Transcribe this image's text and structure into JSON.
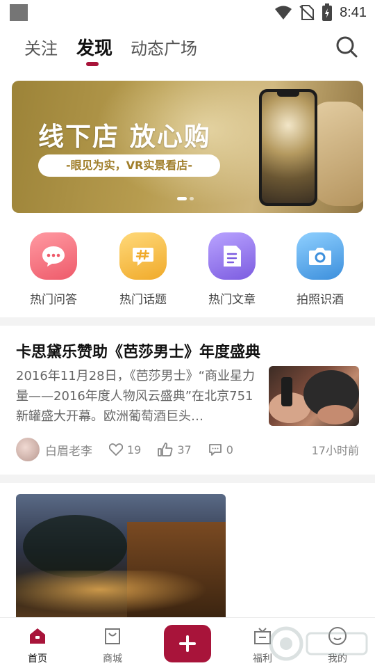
{
  "status_bar": {
    "time": "8:41"
  },
  "tabs": [
    {
      "label": "关注"
    },
    {
      "label": "发现"
    },
    {
      "label": "动态广场"
    }
  ],
  "banner": {
    "title": "线下店 放心购",
    "subtitle": "-眼见为实，VR实景看店-",
    "slide_count": 2,
    "active_slide": 1
  },
  "quick_links": [
    {
      "label": "热门问答",
      "icon": "chat-bubble-icon",
      "color": "#f26b78"
    },
    {
      "label": "热门话题",
      "icon": "hashtag-icon",
      "color": "#f3b93a"
    },
    {
      "label": "热门文章",
      "icon": "document-icon",
      "color": "#8e6fe6"
    },
    {
      "label": "拍照识酒",
      "icon": "camera-icon",
      "color": "#57a9e8"
    }
  ],
  "article": {
    "title": "卡思黛乐赞助《芭莎男士》年度盛典",
    "excerpt": "2016年11月28日，《芭莎男士》“商业星力量——2016年度人物风云盛典”在北京751新罐盛大开幕。欧洲葡萄酒巨头…",
    "author": "白眉老李",
    "likes": "19",
    "thumbs": "37",
    "comments": "0",
    "time": "17小时前"
  },
  "bottom_nav": [
    {
      "label": "首页",
      "icon": "home-icon"
    },
    {
      "label": "商城",
      "icon": "shopping-bag-icon"
    },
    {
      "label": "福利",
      "icon": "tv-gift-icon"
    },
    {
      "label": "我的",
      "icon": "profile-icon"
    }
  ],
  "colors": {
    "accent": "#a8143a"
  }
}
